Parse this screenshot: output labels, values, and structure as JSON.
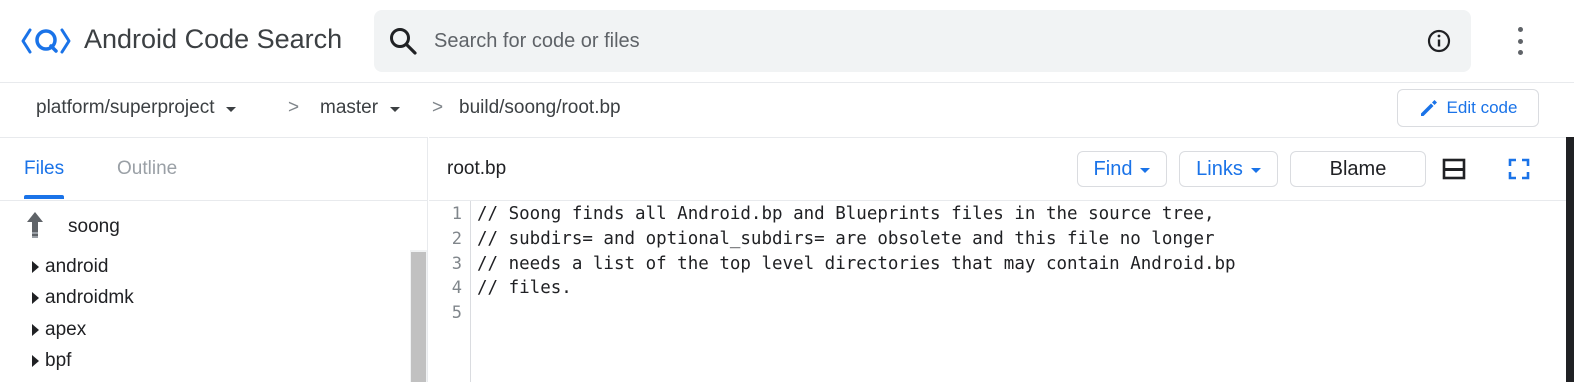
{
  "header": {
    "app_title": "Android Code Search",
    "logo_icon": "android-code-search-logo",
    "search": {
      "placeholder": "Search for code or files",
      "value": ""
    },
    "icons": [
      "search-icon",
      "info-icon",
      "more-vert-icon"
    ]
  },
  "breadcrumb": {
    "project": "platform/superproject",
    "branch": "master",
    "path": "build/soong/root.bp",
    "separator": ">",
    "edit_label": "Edit code"
  },
  "sidebar": {
    "tabs": [
      {
        "label": "Files",
        "active": true
      },
      {
        "label": "Outline",
        "active": false
      }
    ],
    "parent_folder": "soong",
    "items": [
      "android",
      "androidmk",
      "apex",
      "bpf"
    ]
  },
  "code": {
    "filename": "root.bp",
    "toolbar": {
      "find": "Find",
      "links": "Links",
      "blame": "Blame"
    },
    "lines": [
      {
        "n": "1",
        "text": "// Soong finds all Android.bp and Blueprints files in the source tree,"
      },
      {
        "n": "2",
        "text": "// subdirs= and optional_subdirs= are obsolete and this file no longer"
      },
      {
        "n": "3",
        "text": "// needs a list of the top level directories that may contain Android.bp"
      },
      {
        "n": "4",
        "text": "// files."
      },
      {
        "n": "5",
        "text": ""
      }
    ]
  },
  "colors": {
    "accent": "#1a73e8",
    "text": "#202124",
    "muted": "#5f6368",
    "search_bg": "#f1f3f4"
  }
}
